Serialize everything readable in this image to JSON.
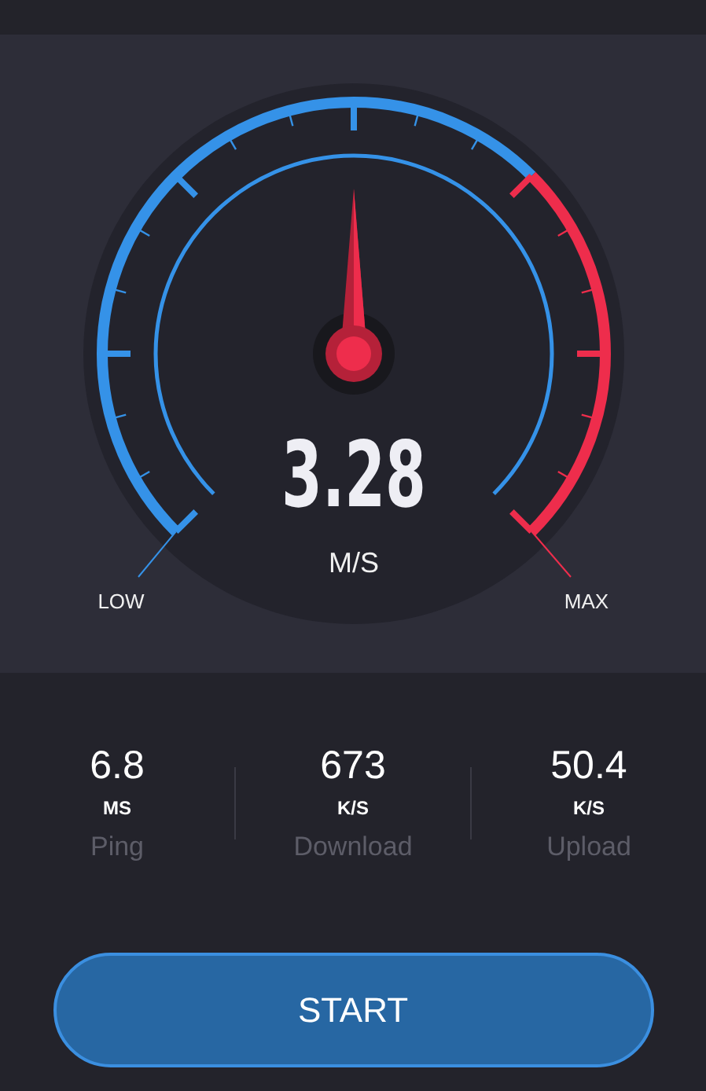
{
  "gauge": {
    "reading": "3.28",
    "unit": "M/S",
    "low_label": "LOW",
    "max_label": "MAX"
  },
  "stats": [
    {
      "value": "6.8",
      "unit": "MS",
      "label": "Ping"
    },
    {
      "value": "673",
      "unit": "K/S",
      "label": "Download"
    },
    {
      "value": "50.4",
      "unit": "K/S",
      "label": "Upload"
    }
  ],
  "start_button": {
    "label": "START"
  }
}
